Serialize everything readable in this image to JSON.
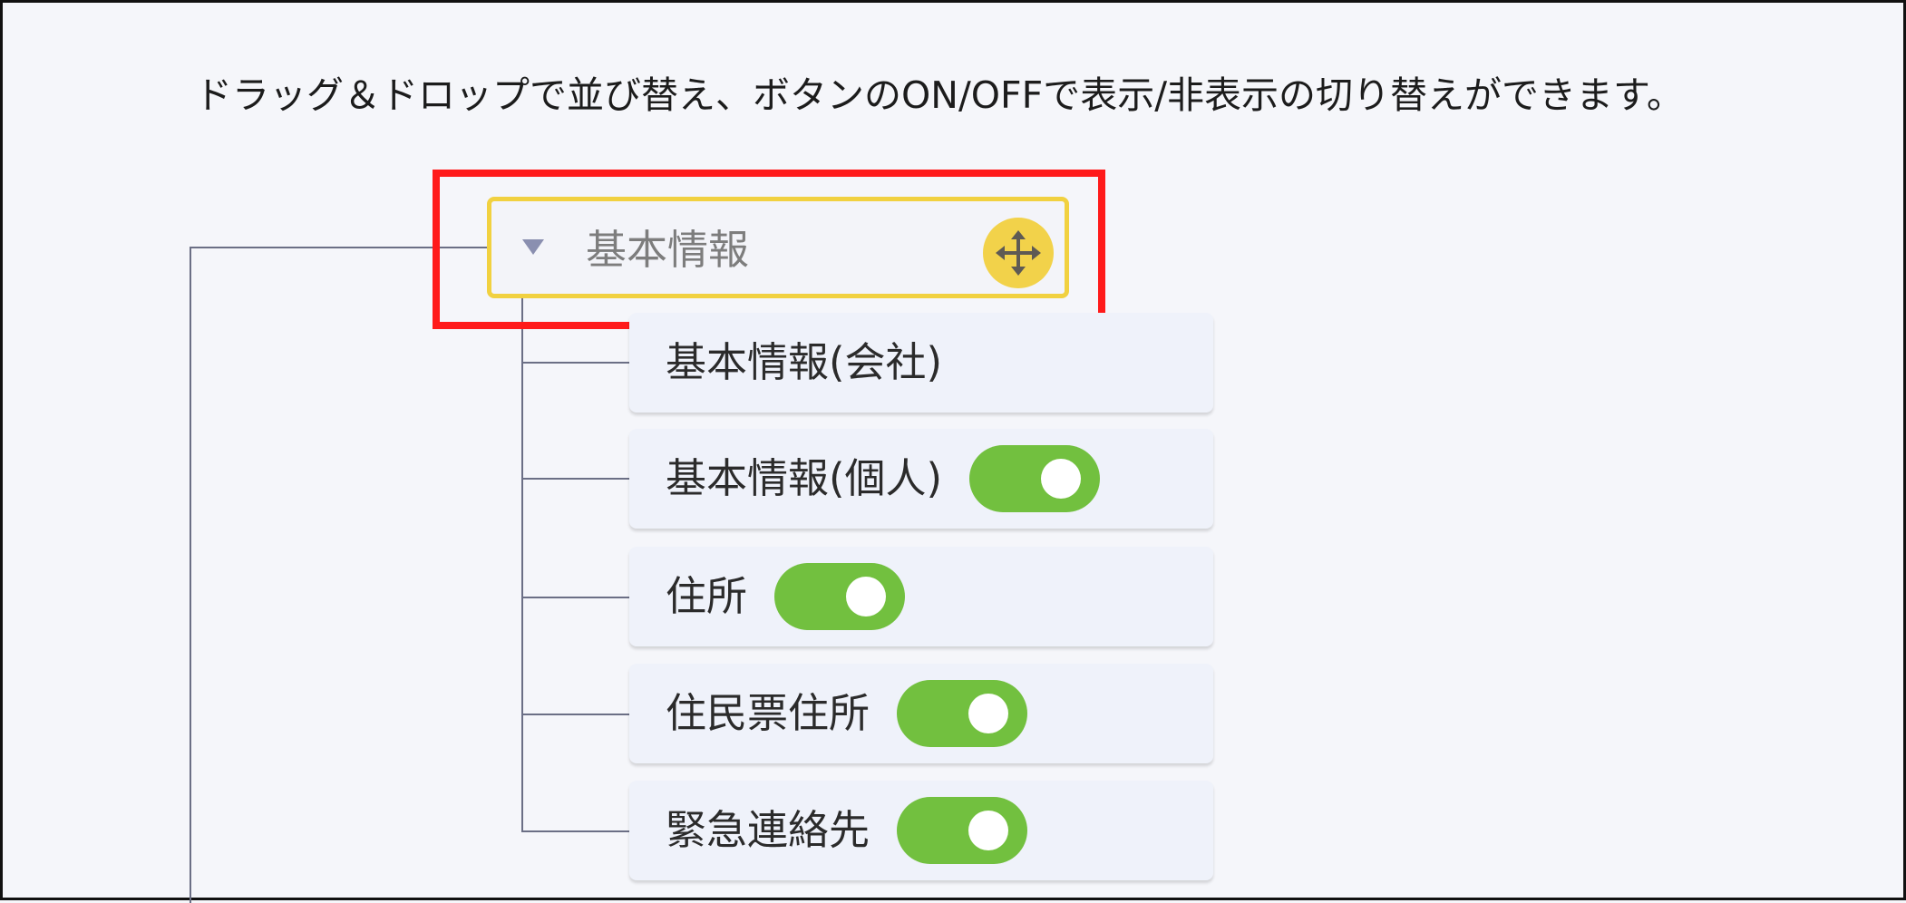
{
  "instruction_text": "ドラッグ＆ドロップで並び替え、ボタンのON/OFFで表示/非表示の切り替えができます。",
  "group": {
    "label": "基本情報",
    "caret_icon": "caret-down-icon",
    "drag_icon": "move-arrows-icon",
    "accent_color": "#f2d24a"
  },
  "items": [
    {
      "label": "基本情報(会社)",
      "has_toggle": false
    },
    {
      "label": "基本情報(個人)",
      "has_toggle": true,
      "toggle_state": "on"
    },
    {
      "label": "住所",
      "has_toggle": true,
      "toggle_state": "on"
    },
    {
      "label": "住民票住所",
      "has_toggle": true,
      "toggle_state": "on"
    },
    {
      "label": "緊急連絡先",
      "has_toggle": true,
      "toggle_state": "on"
    }
  ],
  "colors": {
    "toggle_on": "#72c03f",
    "highlight": "#ff1a1a",
    "tree_line": "#6b6f85"
  }
}
